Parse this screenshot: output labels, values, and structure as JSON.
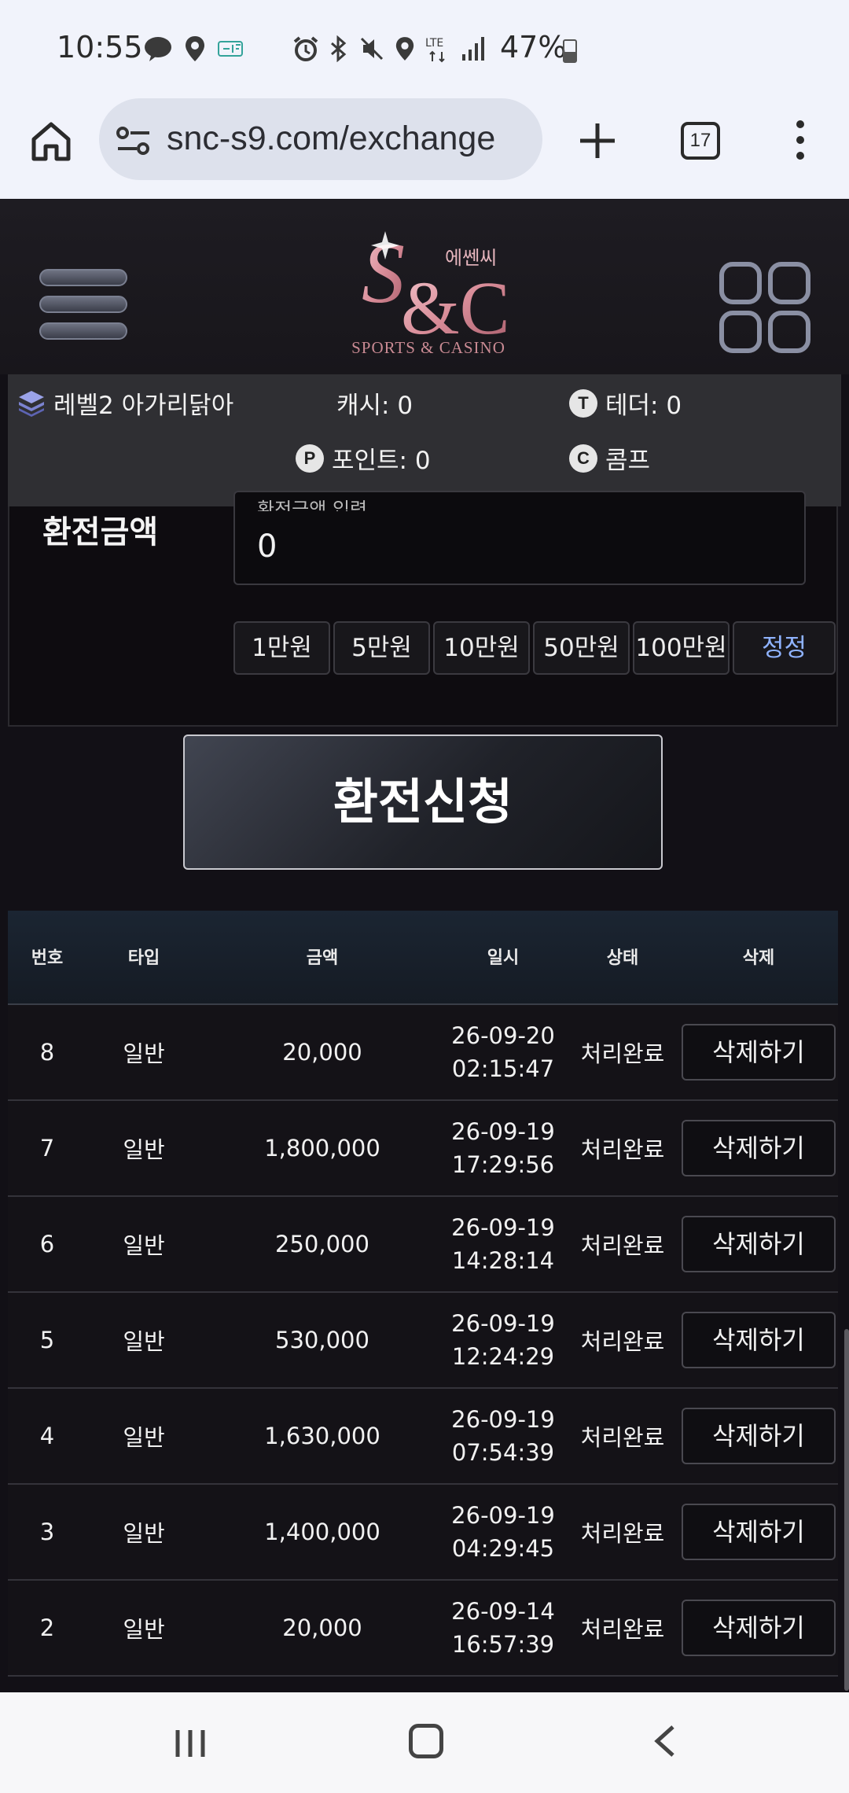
{
  "status_bar": {
    "time": "10:55",
    "right_text": "47%",
    "icons": [
      "talk-icon",
      "location-icon",
      "gif-icon",
      "alarm-icon",
      "bluetooth-icon",
      "mute-icon",
      "location-icon",
      "lte-icon",
      "signal-icon",
      "battery-icon"
    ]
  },
  "browser": {
    "url": "snc-s9.com/exchange",
    "tab_count": "17"
  },
  "logo": {
    "korean": "에쎈씨",
    "tagline": "SPORTS & CASINO"
  },
  "user_info": {
    "level": "레벨2 아가리닭아",
    "cash": "캐시: 0",
    "tether": "테더: 0",
    "point": "포인트: 0",
    "comp": "콤프",
    "tether_icon": "T",
    "point_icon": "P",
    "comp_icon": "C"
  },
  "form": {
    "label": "환전금액",
    "input_caption": "환전금액 입력",
    "input_value": "0",
    "quick_buttons": [
      "1만원",
      "5만원",
      "10만원",
      "50만원",
      "100만원"
    ],
    "reset_label": "정정",
    "apply_label": "환전신청"
  },
  "table": {
    "headers": [
      "번호",
      "타입",
      "금액",
      "일시",
      "상태",
      "삭제"
    ],
    "delete_label": "삭제하기",
    "rows": [
      {
        "no": "8",
        "type": "일반",
        "amount": "20,000",
        "date": "26-09-20",
        "time": "02:15:47",
        "status": "처리완료"
      },
      {
        "no": "7",
        "type": "일반",
        "amount": "1,800,000",
        "date": "26-09-19",
        "time": "17:29:56",
        "status": "처리완료"
      },
      {
        "no": "6",
        "type": "일반",
        "amount": "250,000",
        "date": "26-09-19",
        "time": "14:28:14",
        "status": "처리완료"
      },
      {
        "no": "5",
        "type": "일반",
        "amount": "530,000",
        "date": "26-09-19",
        "time": "12:24:29",
        "status": "처리완료"
      },
      {
        "no": "4",
        "type": "일반",
        "amount": "1,630,000",
        "date": "26-09-19",
        "time": "07:54:39",
        "status": "처리완료"
      },
      {
        "no": "3",
        "type": "일반",
        "amount": "1,400,000",
        "date": "26-09-19",
        "time": "04:29:45",
        "status": "처리완료"
      },
      {
        "no": "2",
        "type": "일반",
        "amount": "20,000",
        "date": "26-09-14",
        "time": "16:57:39",
        "status": "처리완료"
      }
    ]
  }
}
